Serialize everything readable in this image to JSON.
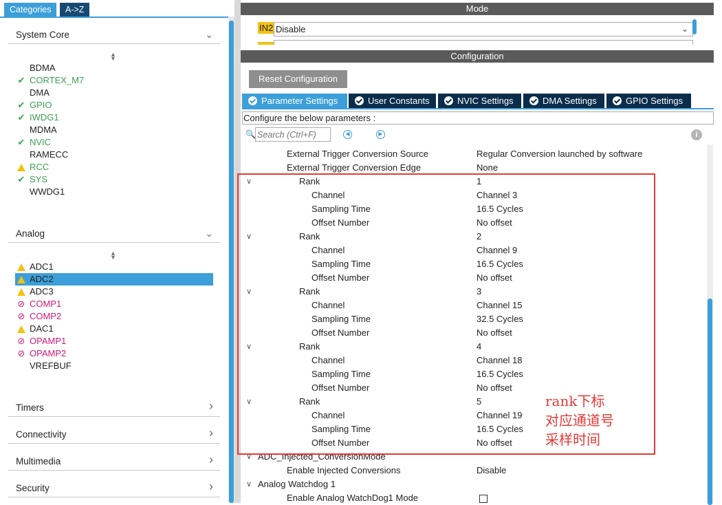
{
  "left_tabs": {
    "categories": "Categories",
    "az": "A->Z"
  },
  "system_core": {
    "title": "System Core",
    "items": [
      {
        "name": "BDMA",
        "status": "none"
      },
      {
        "name": "CORTEX_M7",
        "status": "check"
      },
      {
        "name": "DMA",
        "status": "none"
      },
      {
        "name": "GPIO",
        "status": "check"
      },
      {
        "name": "IWDG1",
        "status": "check"
      },
      {
        "name": "MDMA",
        "status": "none"
      },
      {
        "name": "NVIC",
        "status": "check"
      },
      {
        "name": "RAMECC",
        "status": "none"
      },
      {
        "name": "RCC",
        "status": "warning"
      },
      {
        "name": "SYS",
        "status": "check"
      },
      {
        "name": "WWDG1",
        "status": "none"
      }
    ]
  },
  "analog": {
    "title": "Analog",
    "items": [
      {
        "name": "ADC1",
        "status": "warning"
      },
      {
        "name": "ADC2",
        "status": "warning",
        "selected": true
      },
      {
        "name": "ADC3",
        "status": "warning"
      },
      {
        "name": "COMP1",
        "status": "disabled"
      },
      {
        "name": "COMP2",
        "status": "disabled"
      },
      {
        "name": "DAC1",
        "status": "warning"
      },
      {
        "name": "OPAMP1",
        "status": "disabled"
      },
      {
        "name": "OPAMP2",
        "status": "disabled"
      },
      {
        "name": "VREFBUF",
        "status": "none"
      }
    ]
  },
  "collapsed_categories": [
    "Timers",
    "Connectivity",
    "Multimedia",
    "Security"
  ],
  "mode": {
    "header": "Mode",
    "pin_label": "IN2",
    "pin_value": "Disable"
  },
  "configuration": {
    "header": "Configuration",
    "reset_button": "Reset Configuration",
    "tabs": [
      "Parameter Settings",
      "User Constants",
      "NVIC Settings",
      "DMA Settings",
      "GPIO Settings"
    ],
    "active_tab": "Parameter Settings",
    "hint": "Configure the below parameters :",
    "search_placeholder": "Search (Ctrl+F)"
  },
  "parameters": [
    {
      "level": 2,
      "name": "External Trigger Conversion Source",
      "value": "Regular Conversion launched by software"
    },
    {
      "level": 2,
      "name": "External Trigger Conversion Edge",
      "value": "None"
    },
    {
      "level": 3,
      "name": "Rank",
      "value": "1",
      "group": true
    },
    {
      "level": 4,
      "name": "Channel",
      "value": "Channel 3"
    },
    {
      "level": 4,
      "name": "Sampling Time",
      "value": "16.5 Cycles"
    },
    {
      "level": 4,
      "name": "Offset Number",
      "value": "No offset"
    },
    {
      "level": 3,
      "name": "Rank",
      "value": "2",
      "group": true
    },
    {
      "level": 4,
      "name": "Channel",
      "value": "Channel 9"
    },
    {
      "level": 4,
      "name": "Sampling Time",
      "value": "16.5 Cycles"
    },
    {
      "level": 4,
      "name": "Offset Number",
      "value": "No offset"
    },
    {
      "level": 3,
      "name": "Rank",
      "value": "3",
      "group": true
    },
    {
      "level": 4,
      "name": "Channel",
      "value": "Channel 15"
    },
    {
      "level": 4,
      "name": "Sampling Time",
      "value": "32.5 Cycles"
    },
    {
      "level": 4,
      "name": "Offset Number",
      "value": "No offset"
    },
    {
      "level": 3,
      "name": "Rank",
      "value": "4",
      "group": true
    },
    {
      "level": 4,
      "name": "Channel",
      "value": "Channel 18"
    },
    {
      "level": 4,
      "name": "Sampling Time",
      "value": "16.5 Cycles"
    },
    {
      "level": 4,
      "name": "Offset Number",
      "value": "No offset"
    },
    {
      "level": 3,
      "name": "Rank",
      "value": "5",
      "group": true
    },
    {
      "level": 4,
      "name": "Channel",
      "value": "Channel 19"
    },
    {
      "level": 4,
      "name": "Sampling Time",
      "value": "16.5 Cycles"
    },
    {
      "level": 4,
      "name": "Offset Number",
      "value": "No offset"
    },
    {
      "level": 1,
      "name": "ADC_Injected_ConversionMode",
      "value": "",
      "group": true
    },
    {
      "level": 2,
      "name": "Enable Injected Conversions",
      "value": "Disable"
    },
    {
      "level": 1,
      "name": "Analog Watchdog 1",
      "value": "",
      "group": true
    },
    {
      "level": 2,
      "name": "Enable Analog WatchDog1 Mode",
      "value": "",
      "checkbox": true,
      "checked": false
    }
  ],
  "annotation": {
    "lines": [
      "rank下标",
      "对应通道号",
      "采样时间"
    ],
    "color": "#e53935"
  },
  "colors": {
    "accent": "#3c9fd9",
    "dark_tab": "#0a2d4b",
    "ok": "#3c9f52",
    "warning": "#f2c20f",
    "disabled": "#d0197a"
  }
}
